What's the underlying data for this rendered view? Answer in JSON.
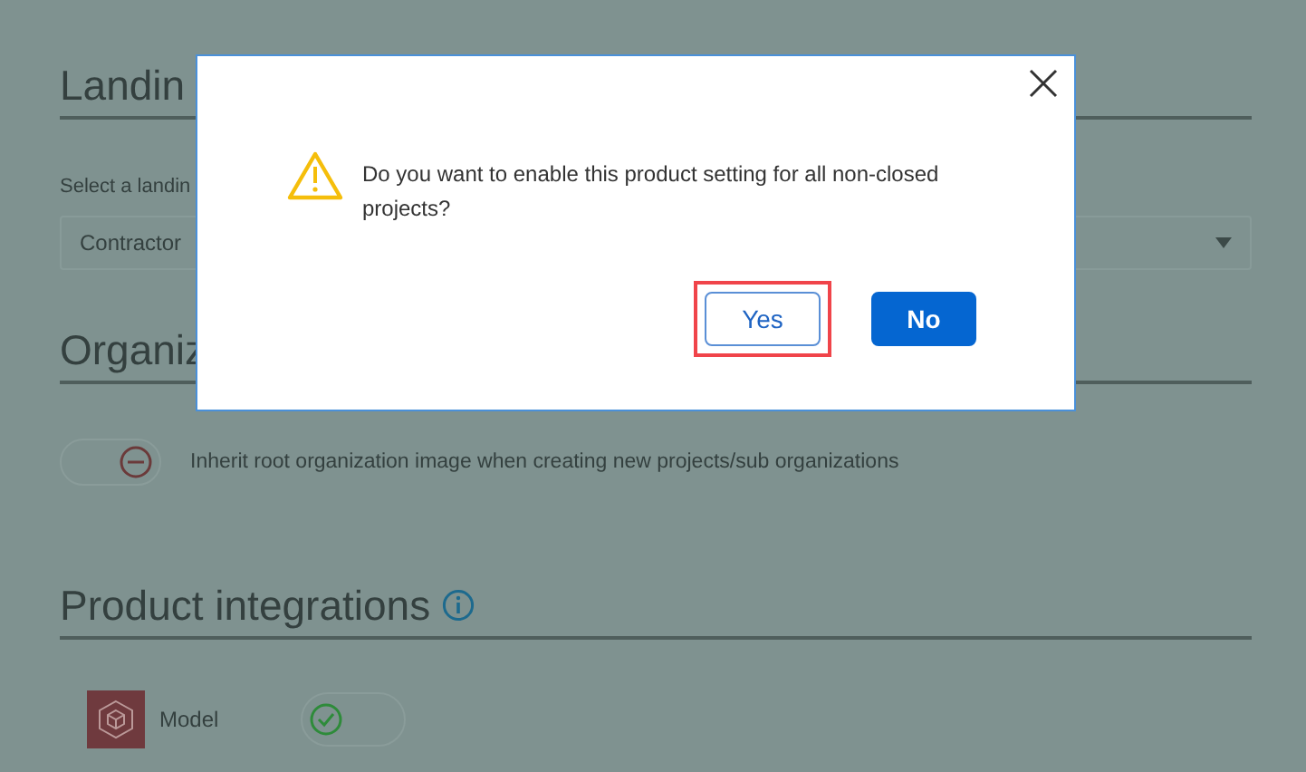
{
  "landing": {
    "heading": "Landin",
    "label": "Select a landin",
    "dropdown": {
      "value": "Contractor"
    }
  },
  "organization": {
    "heading": "Organiz",
    "setting": {
      "on": false,
      "label": "Inherit root organization image when creating new projects/sub organizations"
    }
  },
  "integrations": {
    "heading": "Product integrations",
    "items": [
      {
        "name": "Model",
        "on": true
      }
    ]
  },
  "dialog": {
    "message": "Do you want to enable this product setting for all non-closed projects?",
    "buttons": [
      {
        "label": "Yes",
        "kind": "secondary",
        "highlighted": true
      },
      {
        "label": "No",
        "kind": "primary",
        "highlighted": false
      }
    ]
  }
}
